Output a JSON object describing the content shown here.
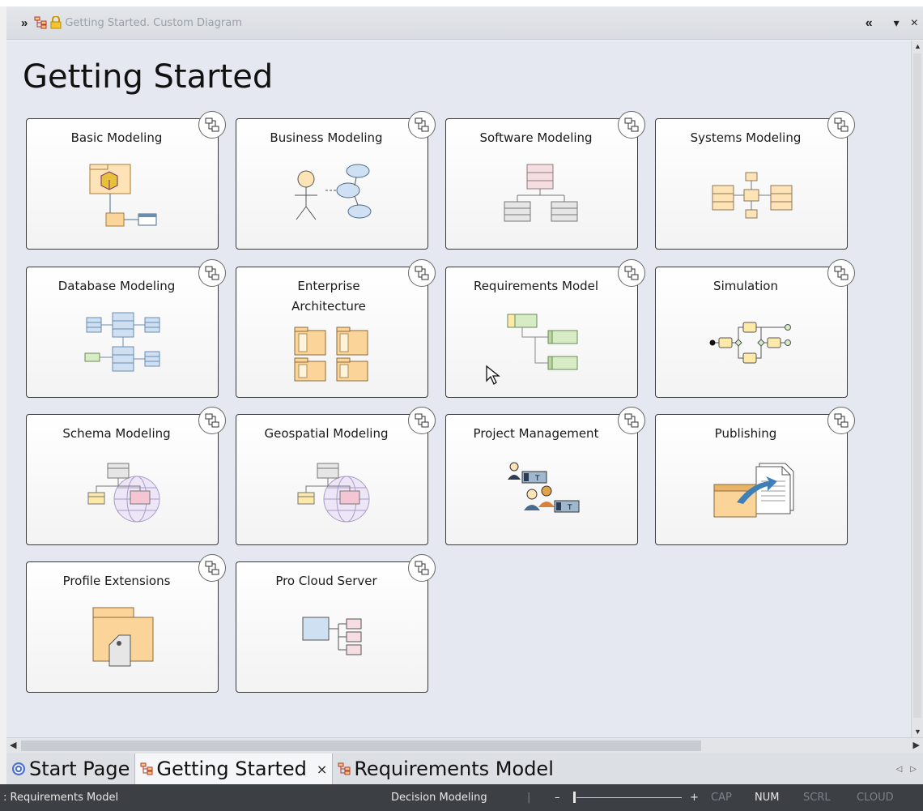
{
  "window": {
    "title": "Getting Started.  Custom Diagram",
    "buttons": {
      "collapse": "«",
      "menu": "▾",
      "close": "×",
      "expand": "»"
    }
  },
  "diagram": {
    "title": "Getting Started",
    "tiles": [
      {
        "label": "Basic Modeling"
      },
      {
        "label": "Business Modeling"
      },
      {
        "label": "Software Modeling"
      },
      {
        "label": "Systems Modeling"
      },
      {
        "label": "Database Modeling"
      },
      {
        "label": "Enterprise Architecture"
      },
      {
        "label": "Requirements Model"
      },
      {
        "label": "Simulation"
      },
      {
        "label": "Schema Modeling"
      },
      {
        "label": "Geospatial Modeling"
      },
      {
        "label": "Project Management"
      },
      {
        "label": "Publishing"
      },
      {
        "label": "Profile Extensions"
      },
      {
        "label": "Pro Cloud Server"
      }
    ]
  },
  "tabs": [
    {
      "label": "Start Page",
      "icon": "start-page-icon"
    },
    {
      "label": "Getting Started",
      "icon": "diagram-icon",
      "active": true,
      "close": "×"
    },
    {
      "label": "Requirements Model",
      "icon": "diagram-icon"
    }
  ],
  "tab_nav": {
    "prev": "◁",
    "next": "▷"
  },
  "status": {
    "context": ": Requirements Model",
    "perspective": "Decision Modeling",
    "zoom_minus": "–",
    "zoom_plus": "+",
    "cap": "CAP",
    "num": "NUM",
    "scrl": "SCRL",
    "cloud": "CLOUD"
  },
  "colors": {
    "canvas": "#e5e8f0",
    "statusbar": "#3c3f44",
    "accent_yellow": "#fde9a8",
    "accent_green": "#d7ecc4",
    "accent_blue": "#cfe0f3",
    "accent_pink": "#f4c6d4"
  }
}
